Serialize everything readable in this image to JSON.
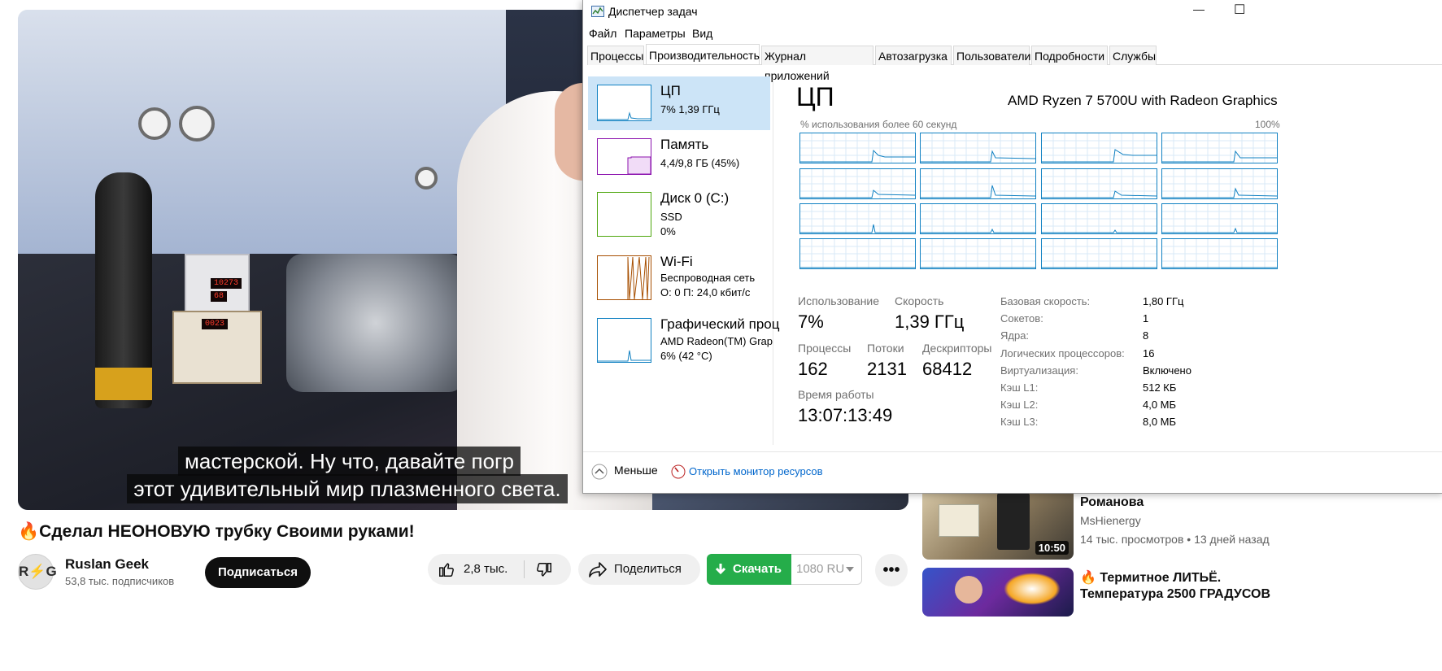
{
  "video": {
    "caption_line1": "мастерской. Ну что, давайте погр",
    "caption_line2": "этот удивительный мир плазменного света."
  },
  "meta": {
    "title": "Сделал НЕОНОВУЮ трубку Своими руками!",
    "channel_avatar_left": "R",
    "channel_avatar_accent": "⚡",
    "channel_avatar_right": "G",
    "channel_name": "Ruslan Geek",
    "subscribers": "53,8 тыс. подписчиков",
    "subscribe_label": "Подписаться",
    "likes": "2,8 тыс.",
    "share_label": "Поделиться",
    "download_label": "Скачать",
    "quality": "1080",
    "quality_lang": "RU",
    "more_label": "•••"
  },
  "related": [
    {
      "title": "Романова",
      "channel": "MsHienergy",
      "stats": "14 тыс. просмотров • 13 дней назад",
      "duration": "10:50"
    },
    {
      "title": "Термитное ЛИТЬЁ.",
      "title2": "Температура 2500 ГРАДУСОВ"
    }
  ],
  "taskmgr": {
    "window_title": "Диспетчер задач",
    "minimize": "—",
    "maximize": "☐",
    "menu": [
      "Файл",
      "Параметры",
      "Вид"
    ],
    "tabs": [
      "Процессы",
      "Производительность",
      "Журнал приложений",
      "Автозагрузка",
      "Пользователи",
      "Подробности",
      "Службы"
    ],
    "active_tab": "Производительность",
    "left_items": [
      {
        "name": "ЦП",
        "sub1": "7% 1,39 ГГц",
        "color": "#1181c2"
      },
      {
        "name": "Память",
        "sub1": "4,4/9,8 ГБ (45%)",
        "color": "#8b12ae"
      },
      {
        "name": "Диск 0 (C:)",
        "sub1": "SSD",
        "sub2": "0%",
        "color": "#4da60c"
      },
      {
        "name": "Wi-Fi",
        "sub1": "Беспроводная сеть",
        "sub2": "О: 0 П: 24,0 кбит/с",
        "color": "#a74f01"
      },
      {
        "name": "Графический проц",
        "sub1": "AMD Radeon(TM) Grap",
        "sub2": "6% (42 °C)",
        "color": "#1181c2"
      }
    ],
    "detail_title": "ЦП",
    "cpu_model": "AMD Ryzen 7 5700U with Radeon Graphics",
    "graph_label": "% использования более 60 секунд",
    "graph_max": "100%",
    "usage_label": "Использование",
    "usage_value": "7%",
    "speed_label": "Скорость",
    "speed_value": "1,39 ГГц",
    "processes_label": "Процессы",
    "processes_value": "162",
    "threads_label": "Потоки",
    "threads_value": "2131",
    "handles_label": "Дескрипторы",
    "handles_value": "68412",
    "uptime_label": "Время работы",
    "uptime_value": "13:07:13:49",
    "specs": [
      {
        "k": "Базовая скорость:",
        "v": "1,80 ГГц"
      },
      {
        "k": "Сокетов:",
        "v": "1"
      },
      {
        "k": "Ядра:",
        "v": "8"
      },
      {
        "k": "Логических процессоров:",
        "v": "16"
      },
      {
        "k": "Виртуализация:",
        "v": "Включено"
      },
      {
        "k": "Кэш L1:",
        "v": "512 КБ"
      },
      {
        "k": "Кэш L2:",
        "v": "4,0 МБ"
      },
      {
        "k": "Кэш L3:",
        "v": "8,0 МБ"
      }
    ],
    "less_label": "Меньше",
    "monitor_link": "Открыть монитор ресурсов"
  }
}
